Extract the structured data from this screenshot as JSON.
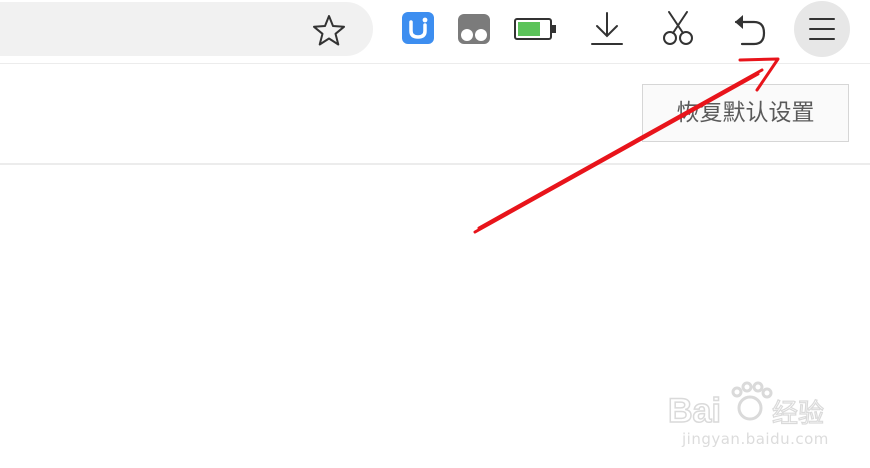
{
  "toolbar": {
    "icons": [
      "star-icon",
      "ext-u-icon",
      "ext-mask-icon",
      "battery-icon",
      "download-icon",
      "scissors-icon",
      "undo-icon",
      "menu-icon"
    ],
    "ext_u_color": "#3d8ef0",
    "battery_fill_color": "#5cc35a",
    "menu_button_bg": "#e7e7e7"
  },
  "settings": {
    "restore_button_label": "恢复默认设置"
  },
  "annotation": {
    "arrow_color": "#e8141b"
  },
  "watermark": {
    "logo_text": "Baidu经验",
    "url_text": "jingyan.baidu.com"
  }
}
